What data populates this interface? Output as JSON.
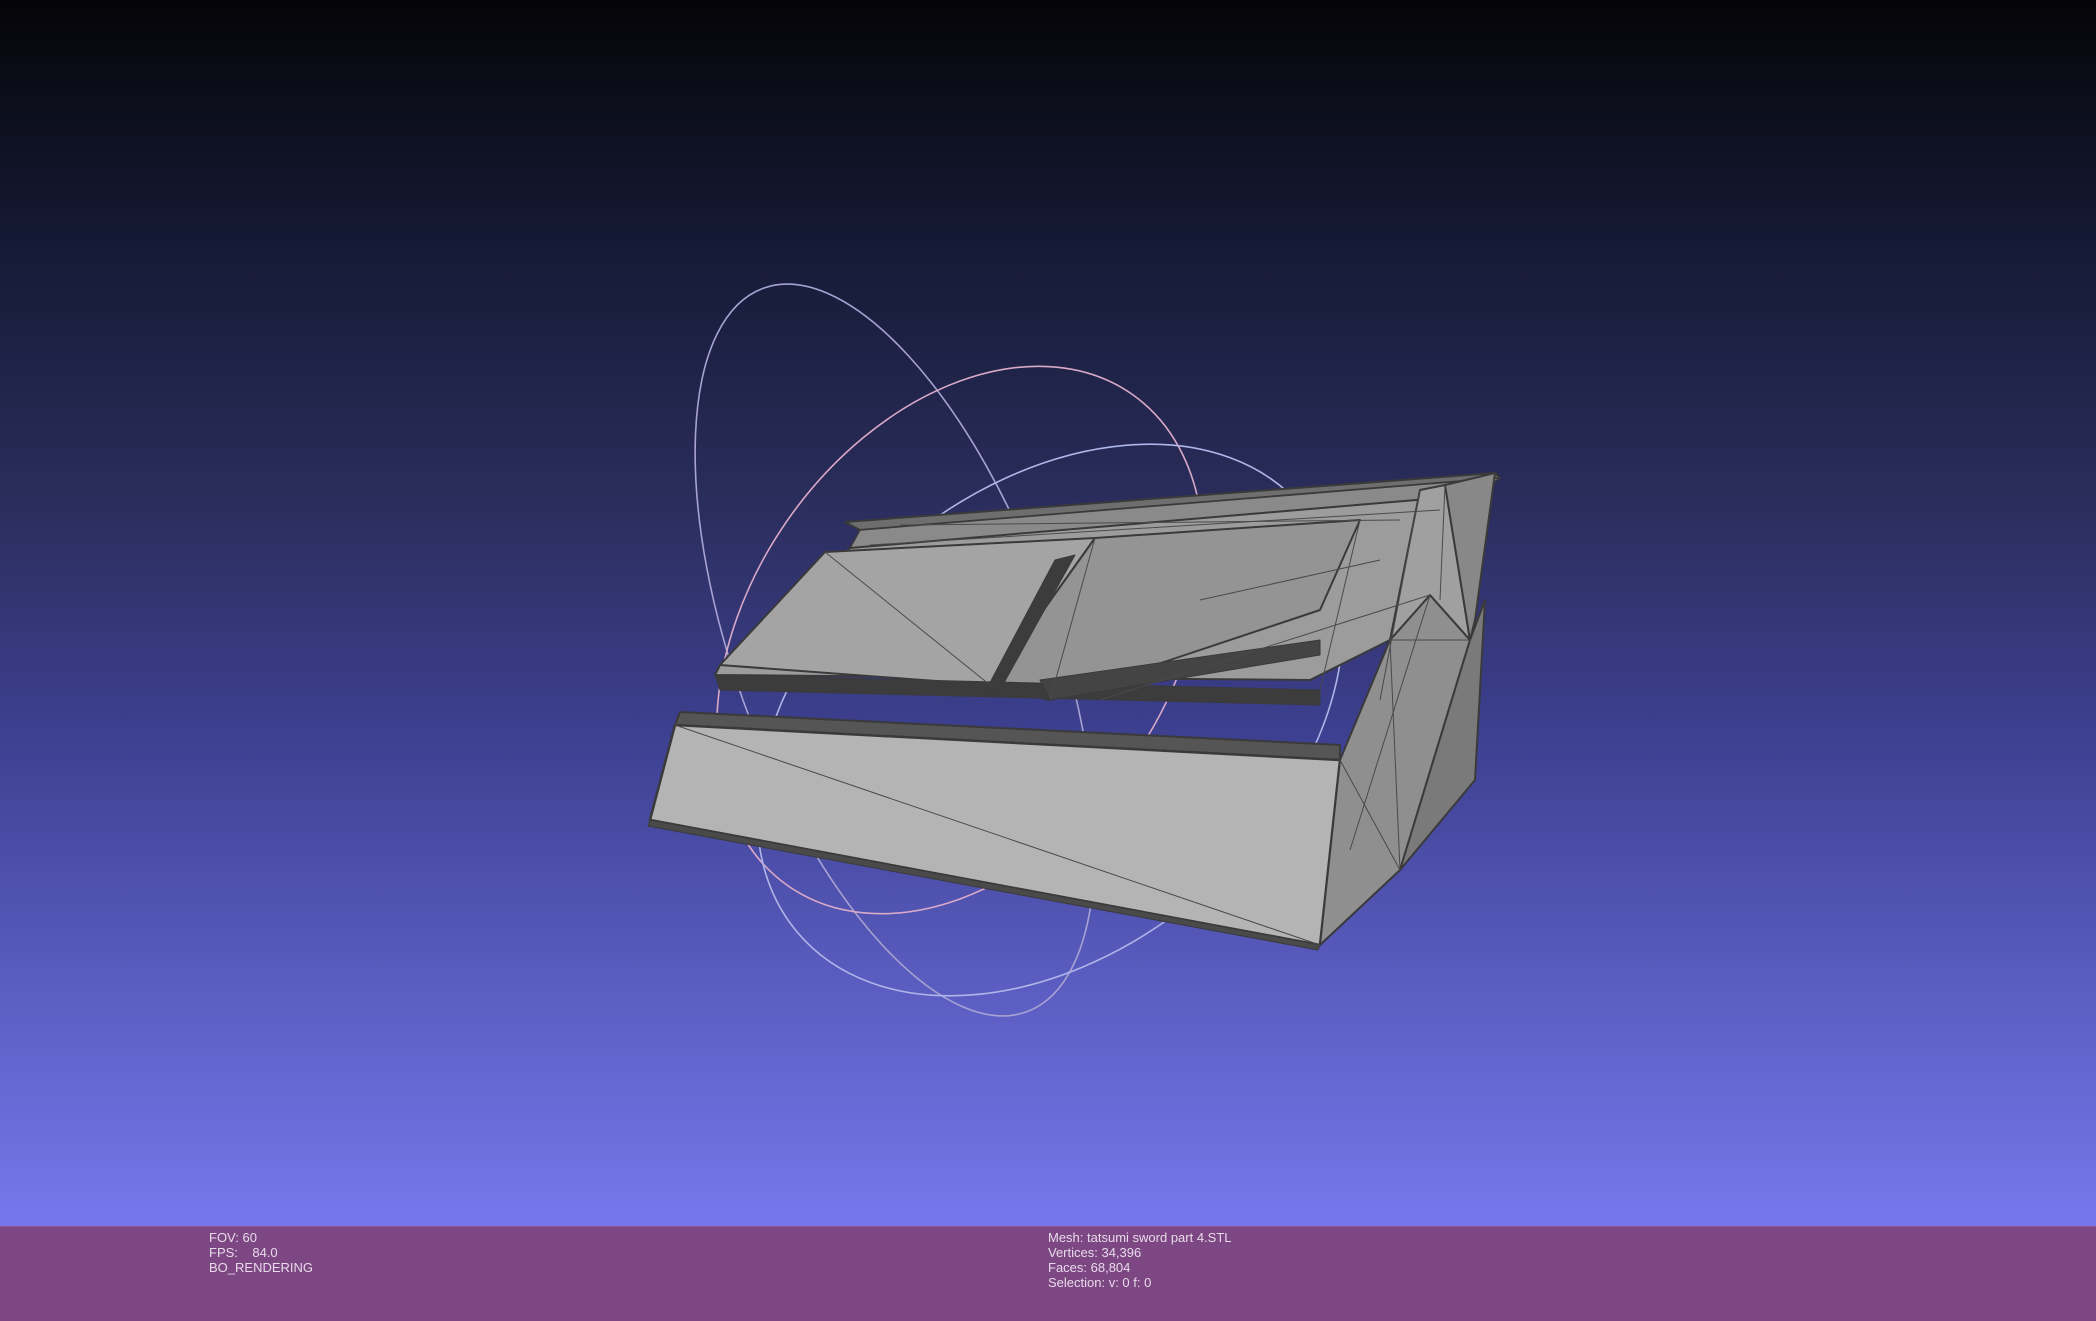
{
  "status_left": {
    "fov": "FOV: 60",
    "fps": "FPS:    84.0",
    "render_mode": "BO_RENDERING"
  },
  "status_right": {
    "mesh": "Mesh: tatsumi sword part 4.STL",
    "vertices": "Vertices: 34,396",
    "faces": "Faces: 68,804",
    "selection": "Selection: v: 0 f: 0"
  },
  "colors": {
    "background_top": "#050508",
    "background_bottom": "#7777ec",
    "status_bar": "#7d4784",
    "mesh_light": "#b4b4b4",
    "mesh_mid": "#9a9a9a",
    "mesh_edge": "#3a3a3a",
    "trackball_arc": "#c9b8e0"
  },
  "icons": {
    "trackball": "trackball-gizmo",
    "mesh": "mesh-model"
  }
}
